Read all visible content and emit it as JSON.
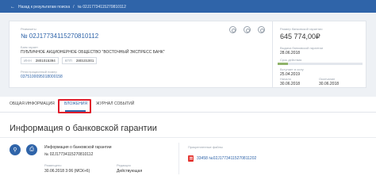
{
  "breadcrumb": {
    "back_label": "Назад к результатам поиска",
    "current": "№ 02J17734115270810112"
  },
  "guarantee": {
    "label": "Реквизиты",
    "number": "№ 02J17734115270810112",
    "bank_label": "Банк гарант",
    "bank_name": "ПУБЛИЧНОЕ АКЦИОНЕРНОЕ ОБЩЕСТВО \"ВОСТОЧНЫЙ ЭКСПРЕСС БАНК\"",
    "inn_label": "ИНН",
    "inn_value": "2801015394",
    "kpp_label": "КПП",
    "kpp_value": "280101001",
    "reg_label": "Регистрационный номер",
    "reg_value": "0375100095018000158"
  },
  "summary": {
    "amount_label": "Размер банковской гарантии",
    "amount": "645 774,00₽",
    "issue_label": "Выдача банковской гарантии",
    "issue_date": "28.06.2018",
    "status_label": "Срок действия",
    "status_progress": 0.12,
    "start_label": "Вступает в силу",
    "start_date": "25.04.2019",
    "from_label": "Начало",
    "from_date": "30.06.2018",
    "to_label": "Окончание",
    "to_date": "30.06.2018"
  },
  "tabs": [
    {
      "label": "ОБЩАЯ ИНФОРМАЦИЯ"
    },
    {
      "label": "ВЛОЖЕНИЯ"
    },
    {
      "label": "ЖУРНАЛ СОБЫТИЙ"
    }
  ],
  "section": {
    "title": "Информация о банковской гарантии",
    "doc_title": "Информация о банковской гарантии",
    "doc_number": "№ 02J17734115270810112",
    "date_label": "Размещено",
    "date_value": "30.06.2018 3:06 (МСК+6)",
    "state_label": "Редакция",
    "state_value": "Действующая",
    "files_label": "Прикрепленные файлы",
    "file_name": "33458 №02J17734115270811202"
  },
  "colors": {
    "brand": "#2f64a9",
    "highlight": "#e01b2a",
    "status": "#8fb36a"
  }
}
